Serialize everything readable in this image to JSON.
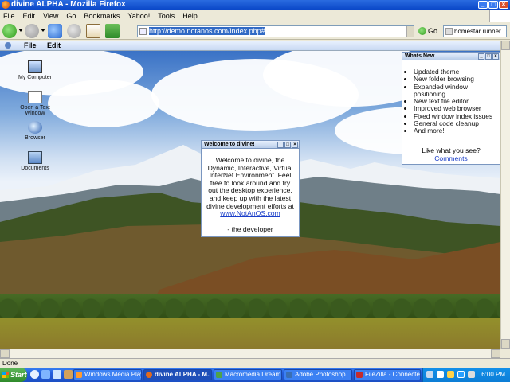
{
  "window": {
    "title": "divine ALPHA - Mozilla Firefox",
    "buttons": [
      "_",
      "□",
      "×"
    ]
  },
  "menu": [
    "File",
    "Edit",
    "View",
    "Go",
    "Bookmarks",
    "Yahoo!",
    "Tools",
    "Help"
  ],
  "nav": {
    "url": "http://demo.notanos.com/index.php#",
    "go_label": "Go",
    "search_value": "homestar runner",
    "icons": [
      "back-icon",
      "forward-icon",
      "reload-icon",
      "stop-icon",
      "home-icon",
      "bookmark-icon",
      "mail-icon"
    ]
  },
  "app_menu": [
    "File",
    "Edit"
  ],
  "desktop_icons": [
    {
      "label": "My Computer",
      "icon": "computer-icon"
    },
    {
      "label": "Open a Text Window",
      "icon": "text-window-icon"
    },
    {
      "label": "Browser",
      "icon": "browser-icon"
    },
    {
      "label": "Documents",
      "icon": "folder-icon"
    }
  ],
  "welcome": {
    "title": "Welcome to divine!",
    "body": "Welcome to divine, the Dynamic, Interactive, Virtual InterNet Environment. Feel free to look around and try out the desktop experience, and keep up with the latest divine development efforts at",
    "link": "www.NotAnOS.com",
    "signature": "- the developer"
  },
  "whats_new": {
    "title": "Whats New",
    "items": [
      "Updated theme",
      "New folder browsing",
      "Expanded window positioning",
      "New text file editor",
      "Improved web browser",
      "Fixed window index issues",
      "General code cleanup",
      "And more!"
    ],
    "question": "Like what you see?",
    "link": "Comments"
  },
  "status": "Done",
  "taskbar": {
    "start": "Start",
    "tasks": [
      "Windows Media Player",
      "divine ALPHA - M...",
      "Macromedia Dream...",
      "Adobe Photoshop",
      "FileZilla - Connected..."
    ],
    "clock": "6:00 PM"
  },
  "colors": {
    "titlebar": "#0a47c8",
    "taskbar": "#245edb",
    "link": "#1a3ec9",
    "start": "#2f8a2a"
  }
}
